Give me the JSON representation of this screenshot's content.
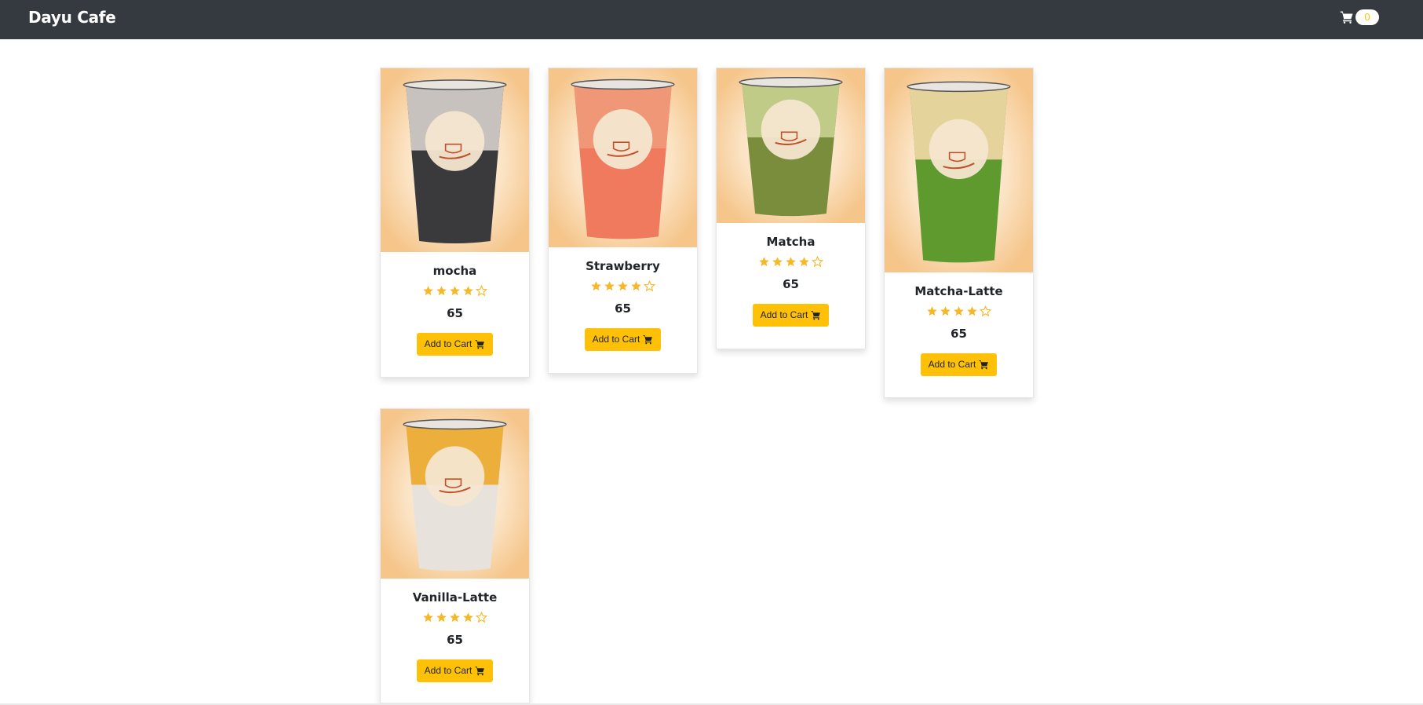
{
  "navbar": {
    "brand": "Dayu Cafe",
    "cart_count": "0",
    "cart_icon": "shopping-cart-icon"
  },
  "colors": {
    "navbar_bg": "#343a40",
    "accent": "#ffc107",
    "star": "#f5b829",
    "card_image_bg": "#f5c58a"
  },
  "products": [
    {
      "name": "mocha",
      "price": "65",
      "rating": 4,
      "rating_max": 5,
      "button_label": "Add to Cart",
      "drink_color": "#3a3a3c",
      "cup_top_color": "#d8d2cc"
    },
    {
      "name": "Strawberry",
      "price": "65",
      "rating": 4,
      "rating_max": 5,
      "button_label": "Add to Cart",
      "drink_color": "#ef7a5d",
      "cup_top_color": "#f09a7a"
    },
    {
      "name": "Matcha",
      "price": "65",
      "rating": 4,
      "rating_max": 5,
      "button_label": "Add to Cart",
      "drink_color": "#7a8d3c",
      "cup_top_color": "#c6d28e"
    },
    {
      "name": "Matcha-Latte",
      "price": "65",
      "rating": 4,
      "rating_max": 5,
      "button_label": "Add to Cart",
      "drink_color": "#5e9a2e",
      "cup_top_color": "#f3d9a7"
    },
    {
      "name": "Vanilla-Latte",
      "price": "65",
      "rating": 4,
      "rating_max": 5,
      "button_label": "Add to Cart",
      "drink_color": "#e7e3dc",
      "cup_top_color": "#eda92a"
    }
  ]
}
